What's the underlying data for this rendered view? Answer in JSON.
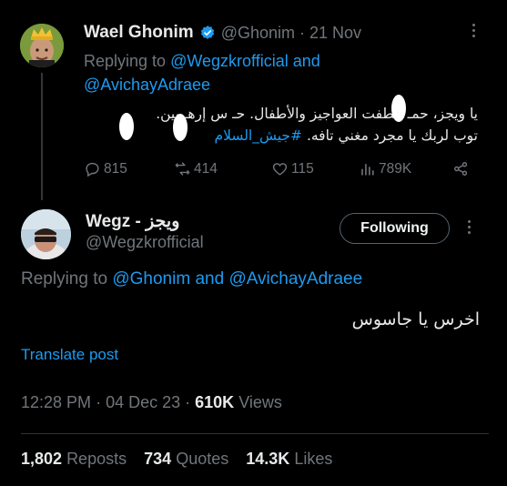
{
  "reply_context": {
    "author_name": "Wael Ghonim",
    "handle": "@Ghonim",
    "date": "21 Nov",
    "replying_prefix": "Replying to",
    "mention_1": "@Wegzkrofficial",
    "and_word": "and",
    "mention_2": "@AvichayAdraee",
    "body_line1": "يا ويجز، حمـ خطفت العواجيز والأطفال. حـ س إرهـ بين.",
    "body_line2_text": "توب لربك يا مجرد مغني تافه.",
    "hashtag": "#جيش_السلام",
    "stats": {
      "replies": "815",
      "reposts": "414",
      "likes": "115",
      "views": "789K"
    }
  },
  "main_tweet": {
    "author_name": "Wegz - ويجز",
    "handle": "@Wegzkrofficial",
    "follow_label": "Following",
    "replying_prefix": "Replying to",
    "mention_1": "@Ghonim",
    "and_word": "and",
    "mention_2": "@AvichayAdraee",
    "body": "اخرس يا جاسوس",
    "translate_label": "Translate post",
    "time": "12:28 PM",
    "date": "04 Dec 23",
    "views_count": "610K",
    "views_label": "Views",
    "reposts_count": "1,802",
    "reposts_label": "Reposts",
    "quotes_count": "734",
    "quotes_label": "Quotes",
    "likes_count": "14.3K",
    "likes_label": "Likes"
  },
  "icons": {
    "verified": "verified-badge-icon",
    "reply": "reply-icon",
    "repost": "repost-icon",
    "like": "heart-icon",
    "views": "views-icon",
    "share": "share-icon",
    "more": "more-icon"
  },
  "colors": {
    "background": "#000000",
    "text": "#e7e9ea",
    "muted": "#71767b",
    "link": "#1d9bf0",
    "divider": "#2f3336"
  }
}
